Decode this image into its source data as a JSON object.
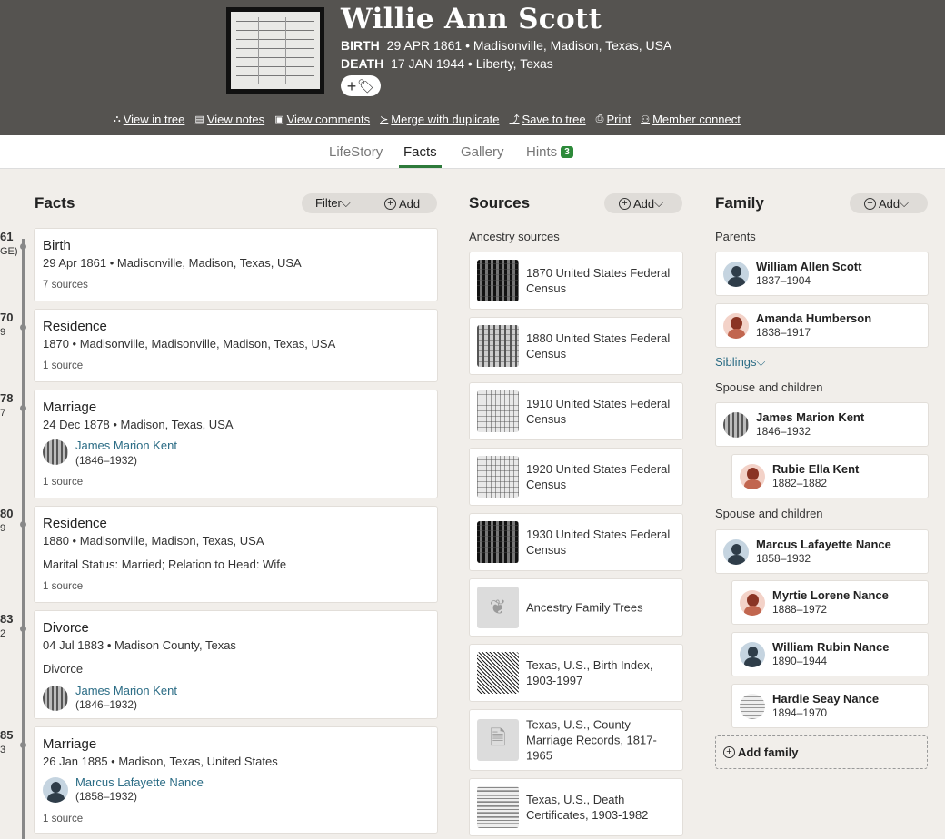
{
  "person": {
    "name": "Willie Ann Scott",
    "birth_label": "BIRTH",
    "birth_value": "29 APR 1861 • Madisonville, Madison, Texas, USA",
    "death_label": "DEATH",
    "death_value": "17 JAN 1944 • Liberty, Texas"
  },
  "actions": [
    {
      "label": "View in tree",
      "icon": "tree-icon"
    },
    {
      "label": "View notes",
      "icon": "notes-icon"
    },
    {
      "label": "View comments",
      "icon": "comments-icon"
    },
    {
      "label": "Merge with duplicate",
      "icon": "merge-icon"
    },
    {
      "label": "Save to tree",
      "icon": "save-icon"
    },
    {
      "label": "Print",
      "icon": "print-icon"
    },
    {
      "label": "Member connect",
      "icon": "member-icon"
    }
  ],
  "tabs": [
    {
      "label": "LifeStory"
    },
    {
      "label": "Facts"
    },
    {
      "label": "Gallery"
    },
    {
      "label": "Hints",
      "badge": "3"
    }
  ],
  "timeline": [
    {
      "year": "61",
      "sub": "GE)"
    },
    {
      "year": "70",
      "sub": "9"
    },
    {
      "year": "78",
      "sub": "7"
    },
    {
      "year": "80",
      "sub": "9"
    },
    {
      "year": "83",
      "sub": "2"
    },
    {
      "year": "85",
      "sub": "3"
    }
  ],
  "facts_section": {
    "title": "Facts",
    "filter_label": "Filter",
    "add_label": "Add"
  },
  "facts": [
    {
      "title": "Birth",
      "line1": "29 Apr 1861 • Madisonville, Madison, Texas, USA",
      "sources": "7 sources"
    },
    {
      "title": "Residence",
      "line1": "1870 • Madisonville, Madisonville, Madison, Texas, USA",
      "sources": "1 source"
    },
    {
      "title": "Marriage",
      "line1": "24 Dec 1878 • Madison, Texas, USA",
      "person": "James Marion Kent",
      "person_dates": "(1846–1932)",
      "sources": "1 source"
    },
    {
      "title": "Residence",
      "line1": "1880 • Madisonville, Madison, Texas, USA",
      "line2": "Marital Status: Married; Relation to Head: Wife",
      "sources": "1 source"
    },
    {
      "title": "Divorce",
      "line1": "04 Jul 1883 • Madison County, Texas",
      "line2": "Divorce",
      "person": "James Marion Kent",
      "person_dates": "(1846–1932)"
    },
    {
      "title": "Marriage",
      "line1": "26 Jan 1885 • Madison, Texas, United States",
      "person": "Marcus Lafayette Nance",
      "person_dates": "(1858–1932)",
      "sources": "1 source"
    }
  ],
  "sources_section": {
    "title": "Sources",
    "add_label": "Add",
    "sublabel": "Ancestry sources"
  },
  "sources": [
    {
      "title": "1870 United States Federal Census",
      "thumb": "microfilm"
    },
    {
      "title": "1880 United States Federal Census",
      "thumb": "microfilm"
    },
    {
      "title": "1910 United States Federal Census",
      "thumb": "microfilm"
    },
    {
      "title": "1920 United States Federal Census",
      "thumb": "microfilm"
    },
    {
      "title": "1930 United States Federal Census",
      "thumb": "microfilm"
    },
    {
      "title": "Ancestry Family Trees",
      "thumb": "leaf-icon"
    },
    {
      "title": "Texas, U.S., Birth Index, 1903-1997",
      "thumb": "speckle"
    },
    {
      "title": "Texas, U.S., County Marriage Records, 1817-1965",
      "thumb": "document-icon"
    },
    {
      "title": "Texas, U.S., Death Certificates, 1903-1982",
      "thumb": "document"
    }
  ],
  "family_section": {
    "title": "Family",
    "add_label": "Add",
    "parents_label": "Parents",
    "siblings_label": "Siblings",
    "spouse_label_1": "Spouse and children",
    "spouse_label_2": "Spouse and children",
    "add_family_label": "Add family"
  },
  "family": {
    "parents": [
      {
        "name": "William Allen Scott",
        "dates": "1837–1904",
        "avatar": "male"
      },
      {
        "name": "Amanda Humberson",
        "dates": "1838–1917",
        "avatar": "female"
      }
    ],
    "spouse1": {
      "name": "James Marion Kent",
      "dates": "1846–1932",
      "avatar": "photo"
    },
    "children1": [
      {
        "name": "Rubie Ella Kent",
        "dates": "1882–1882",
        "avatar": "female"
      }
    ],
    "spouse2": {
      "name": "Marcus Lafayette Nance",
      "dates": "1858–1932",
      "avatar": "male"
    },
    "children2": [
      {
        "name": "Myrtie Lorene Nance",
        "dates": "1888–1972",
        "avatar": "female"
      },
      {
        "name": "William Rubin Nance",
        "dates": "1890–1944",
        "avatar": "male"
      },
      {
        "name": "Hardie Seay Nance",
        "dates": "1894–1970",
        "avatar": "doc"
      }
    ]
  }
}
